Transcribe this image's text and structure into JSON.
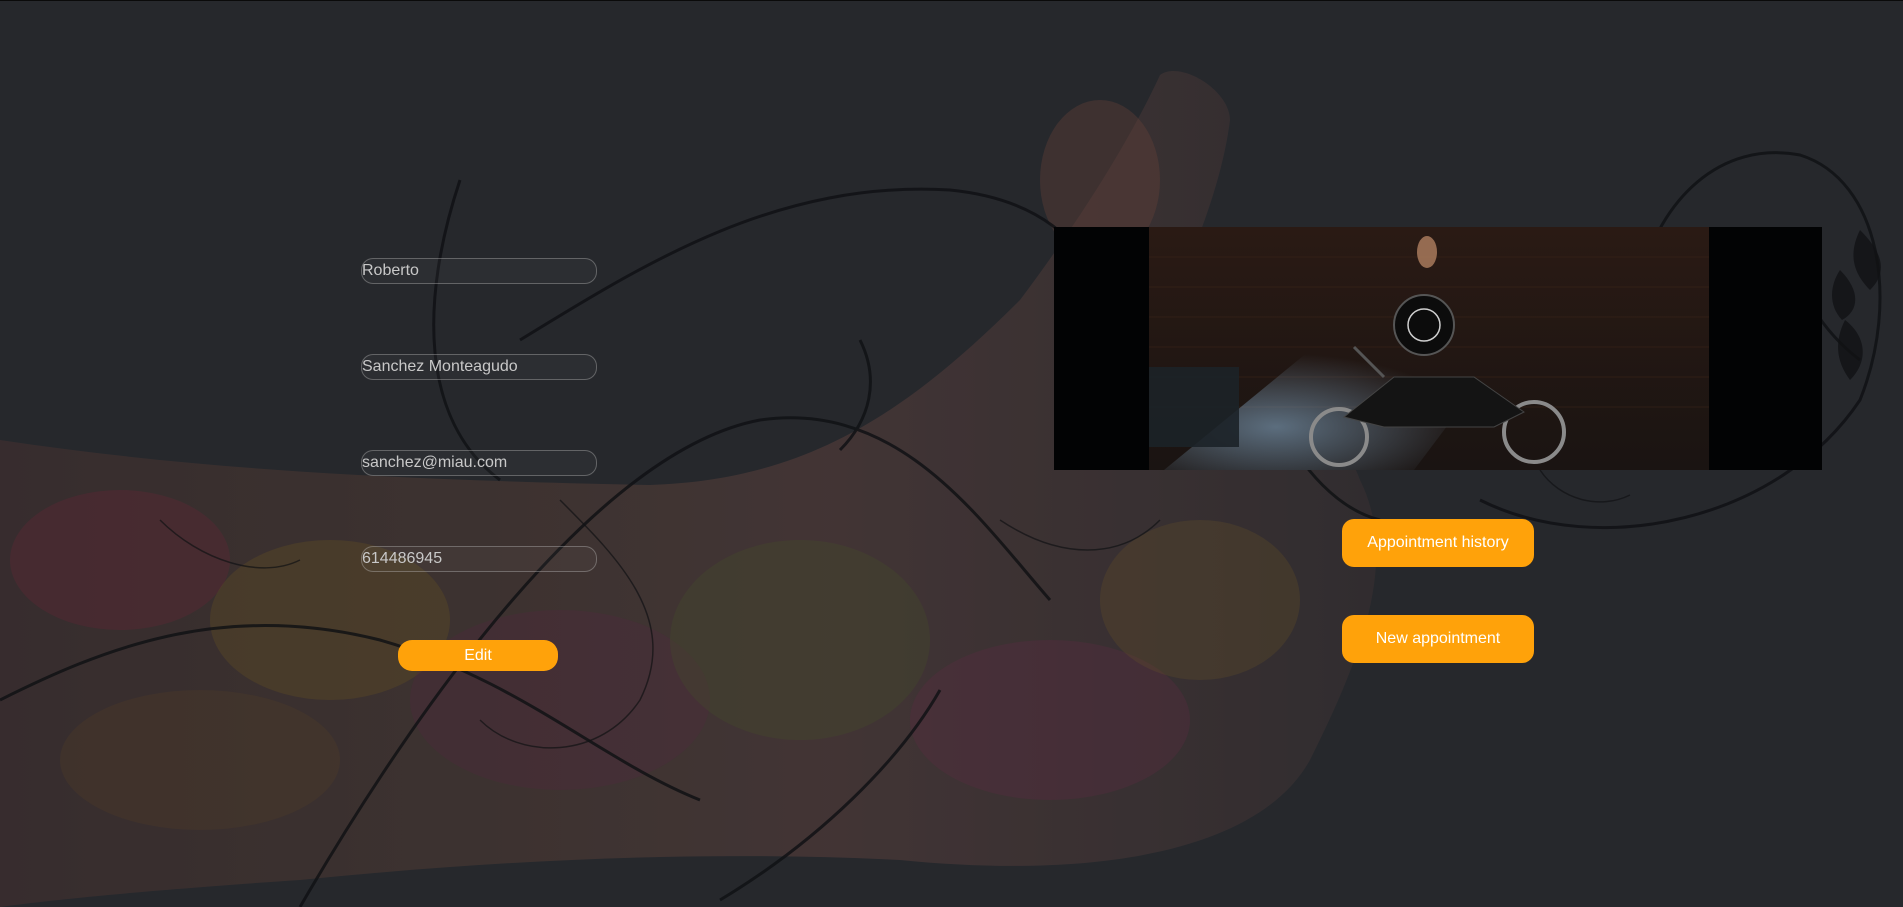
{
  "profile": {
    "first_name": "Roberto",
    "last_name": "Sanchez Monteagudo",
    "email": "sanchez@miau.com",
    "phone": "614486945"
  },
  "actions": {
    "edit_label": "Edit",
    "appointment_history_label": "Appointment history",
    "new_appointment_label": "New appointment"
  },
  "colors": {
    "accent": "#ffa20a",
    "background": "#2b2d31"
  }
}
